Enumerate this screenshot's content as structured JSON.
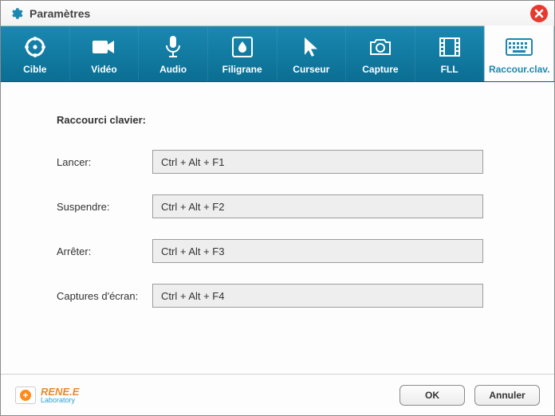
{
  "window": {
    "title": "Paramètres"
  },
  "tabs": [
    {
      "label": "Cible"
    },
    {
      "label": "Vidéo"
    },
    {
      "label": "Audio"
    },
    {
      "label": "Filigrane"
    },
    {
      "label": "Curseur"
    },
    {
      "label": "Capture"
    },
    {
      "label": "FLL"
    },
    {
      "label": "Raccour.clav."
    }
  ],
  "section": {
    "title": "Raccourci clavier:"
  },
  "shortcuts": {
    "launch": {
      "label": "Lancer:",
      "value": "Ctrl + Alt + F1"
    },
    "suspend": {
      "label": "Suspendre:",
      "value": "Ctrl + Alt + F2"
    },
    "stop": {
      "label": "Arrêter:",
      "value": "Ctrl + Alt + F3"
    },
    "screenshot": {
      "label": "Captures d'écran:",
      "value": "Ctrl + Alt + F4"
    }
  },
  "footer": {
    "ok": "OK",
    "cancel": "Annuler",
    "brand": "RENE.E",
    "brand_sub": "Laboratory"
  }
}
